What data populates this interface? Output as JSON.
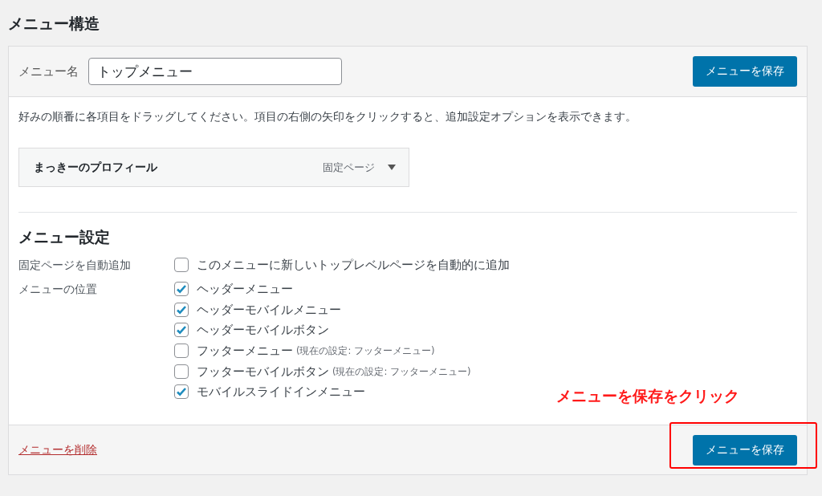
{
  "page_title": "メニュー構造",
  "header": {
    "name_label": "メニュー名",
    "name_value": "トップメニュー",
    "save_button": "メニューを保存"
  },
  "instructions": "好みの順番に各項目をドラッグしてください。項目の右側の矢印をクリックすると、追加設定オプションを表示できます。",
  "menu_items": [
    {
      "title": "まっきーのプロフィール",
      "type": "固定ページ",
      "expanded": false
    }
  ],
  "settings": {
    "title": "メニュー設定",
    "auto_add": {
      "label": "固定ページを自動追加",
      "option": "このメニューに新しいトップレベルページを自動的に追加",
      "checked": false
    },
    "locations_label": "メニューの位置",
    "locations": [
      {
        "label": "ヘッダーメニュー",
        "checked": true
      },
      {
        "label": "ヘッダーモバイルメニュー",
        "checked": true
      },
      {
        "label": "ヘッダーモバイルボタン",
        "checked": true
      },
      {
        "label": "フッターメニュー",
        "note": "(現在の設定: フッターメニュー)",
        "checked": false
      },
      {
        "label": "フッターモバイルボタン",
        "note": "(現在の設定: フッターメニュー)",
        "checked": false
      },
      {
        "label": "モバイルスライドインメニュー",
        "checked": true
      }
    ]
  },
  "footer": {
    "delete_link": "メニューを削除",
    "save_button": "メニューを保存"
  },
  "annotation": {
    "text": "メニューを保存をクリック"
  }
}
